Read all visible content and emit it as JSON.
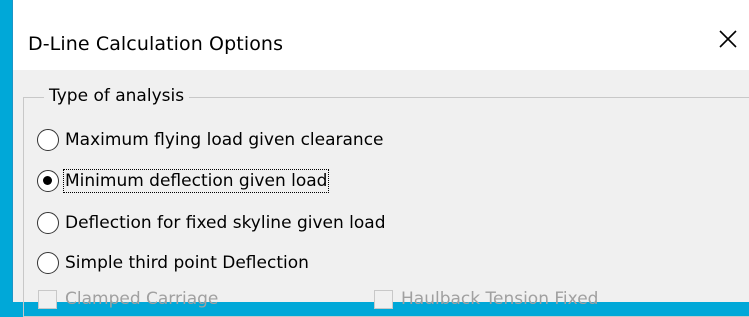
{
  "dialog": {
    "title": "D-Line Calculation Options",
    "close_icon": "close-icon"
  },
  "analysis": {
    "legend": "Type of analysis",
    "options": [
      {
        "label": "Maximum flying load given clearance",
        "checked": false
      },
      {
        "label": "Minimum deflection given load",
        "checked": true
      },
      {
        "label": "Deflection for fixed skyline given load",
        "checked": false
      },
      {
        "label": "Simple third point Deflection",
        "checked": false
      }
    ]
  },
  "checkboxes": [
    {
      "label": "Clamped Carriage",
      "enabled": false
    },
    {
      "label": "Haulback Tension Fixed",
      "enabled": false
    }
  ]
}
